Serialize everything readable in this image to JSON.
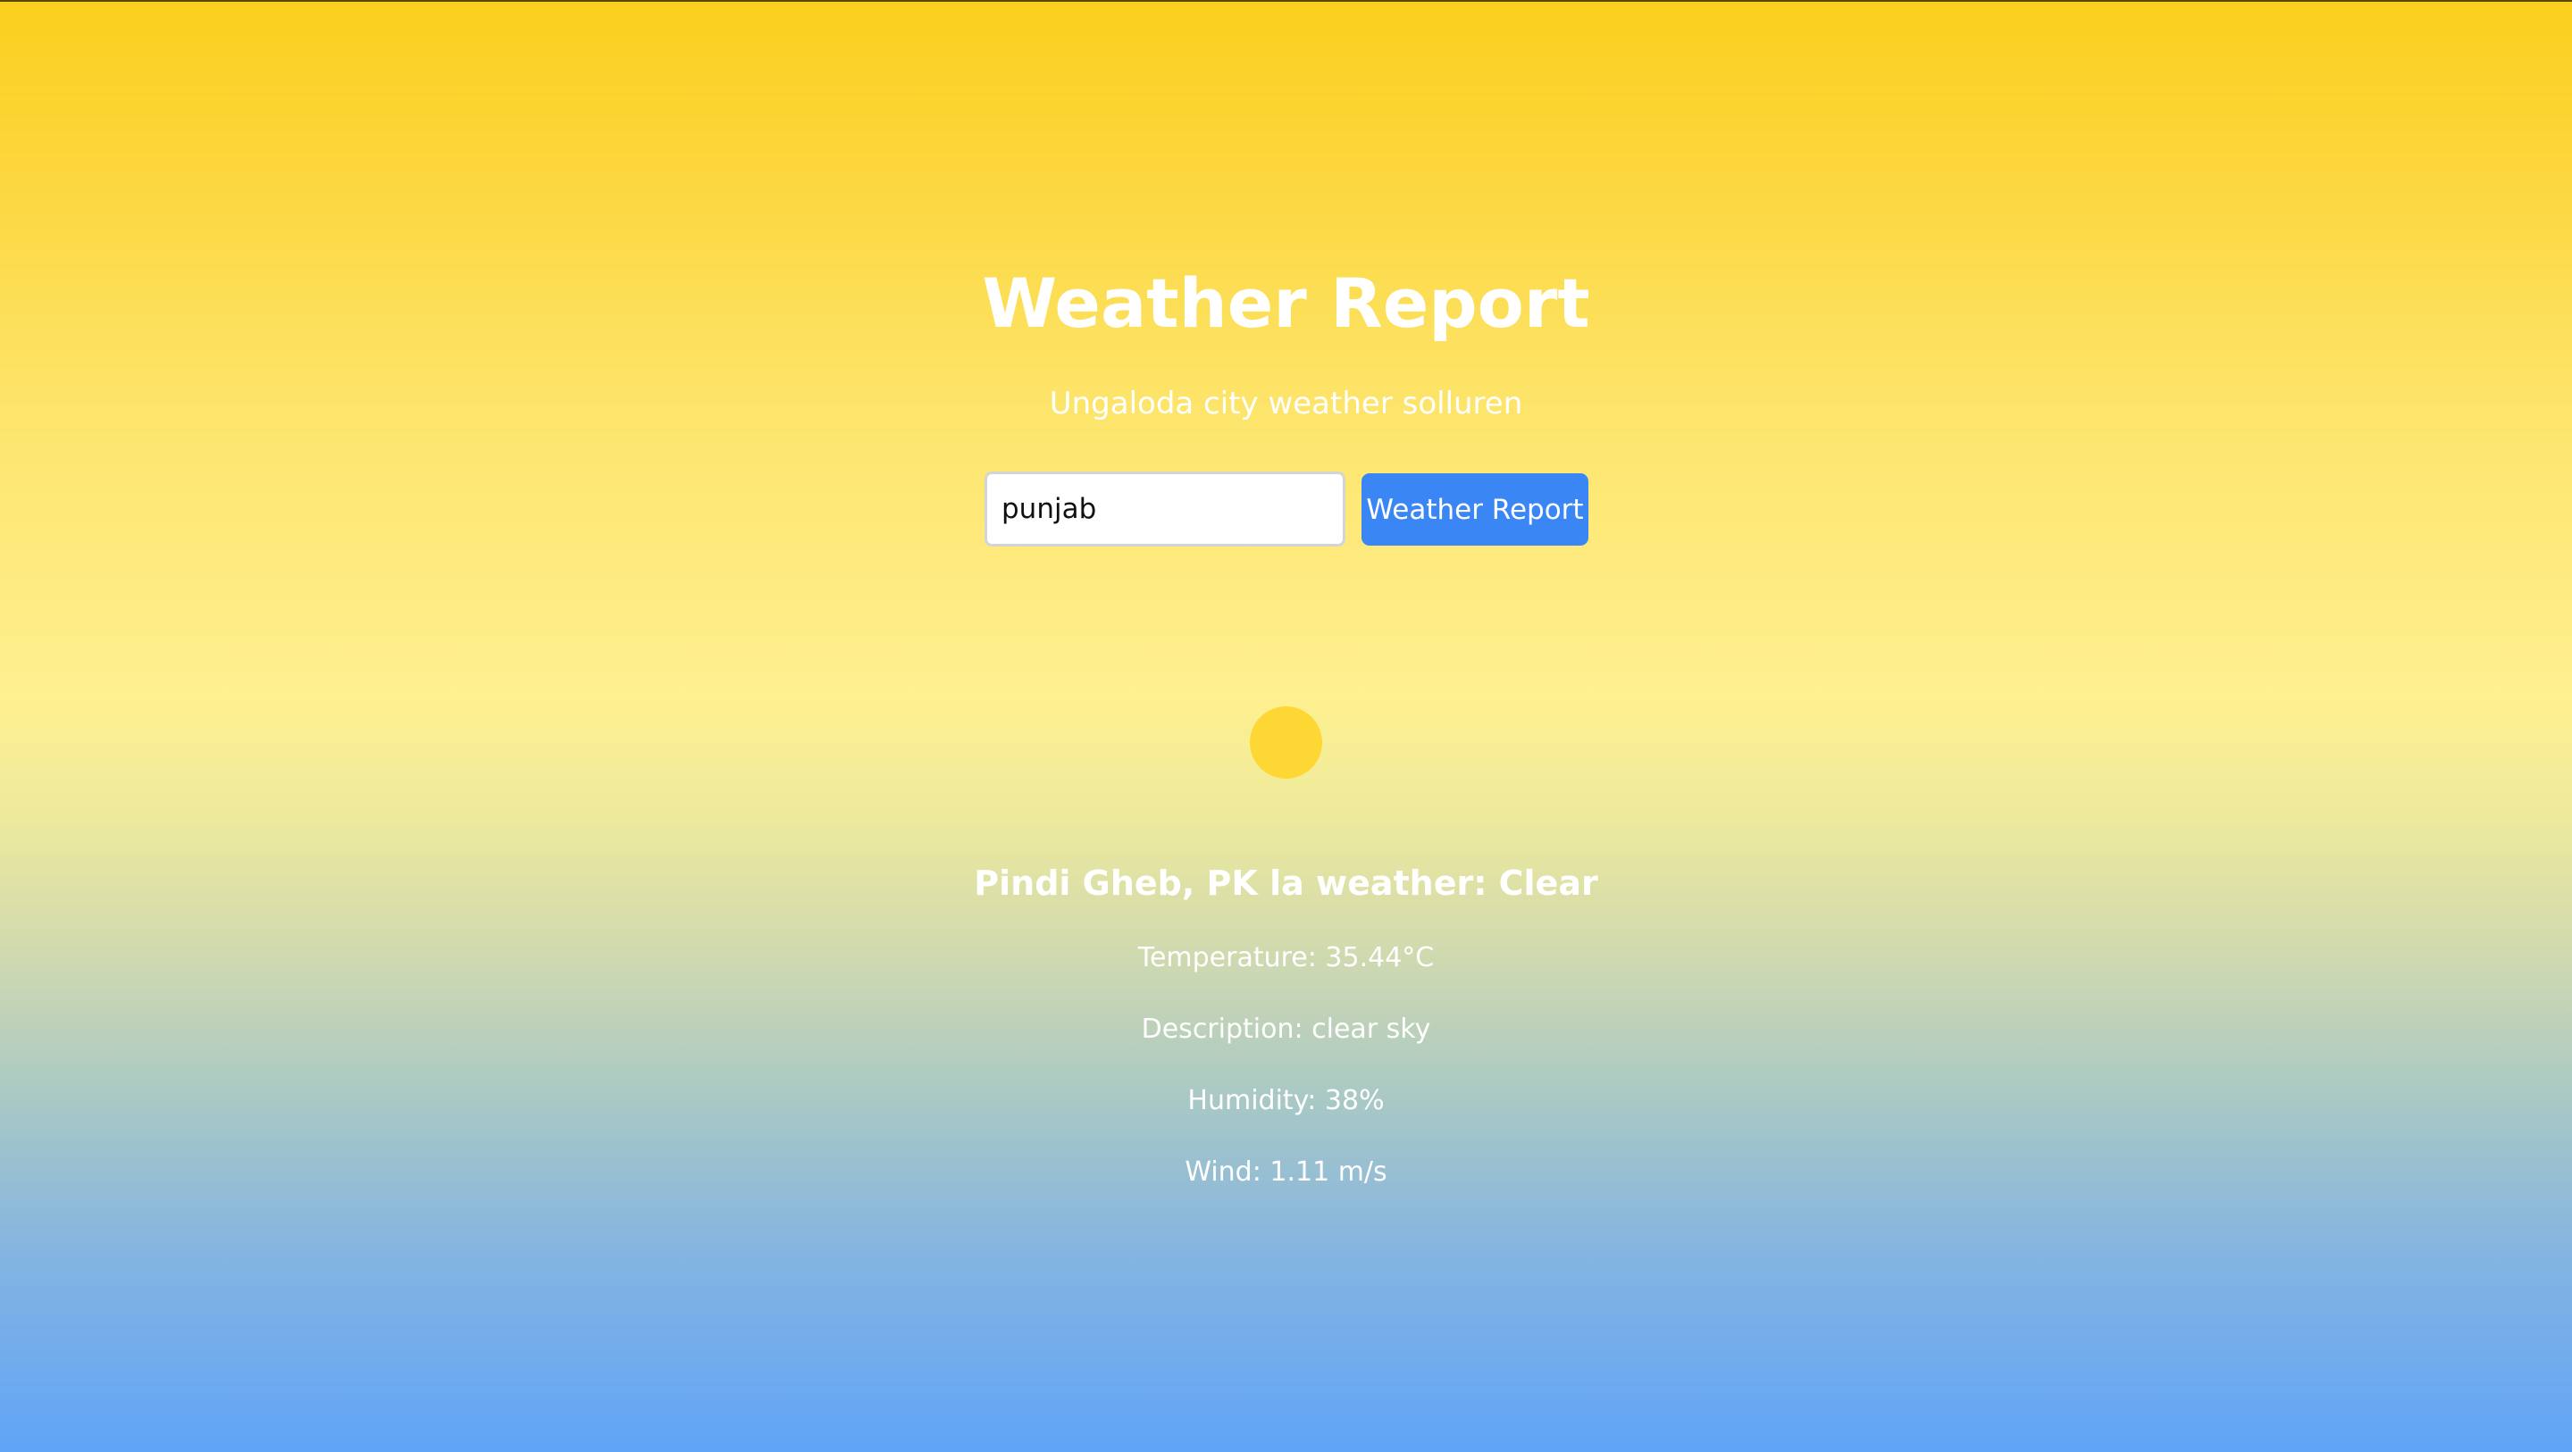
{
  "header": {
    "title": "Weather Report",
    "subtitle": "Ungaloda city weather solluren"
  },
  "search": {
    "value": "punjab",
    "button_label": "Weather Report"
  },
  "weather": {
    "icon": "sun-icon",
    "icon_color": "#fdd835",
    "heading": "Pindi Gheb, PK la weather: Clear",
    "temperature": "Temperature: 35.44°C",
    "description": "Description: clear sky",
    "humidity": "Humidity: 38%",
    "wind": "Wind: 1.11 m/s"
  },
  "colors": {
    "accent": "#3a86f4",
    "background_top": "#fbcf1c",
    "background_bottom": "#60a4f7"
  }
}
